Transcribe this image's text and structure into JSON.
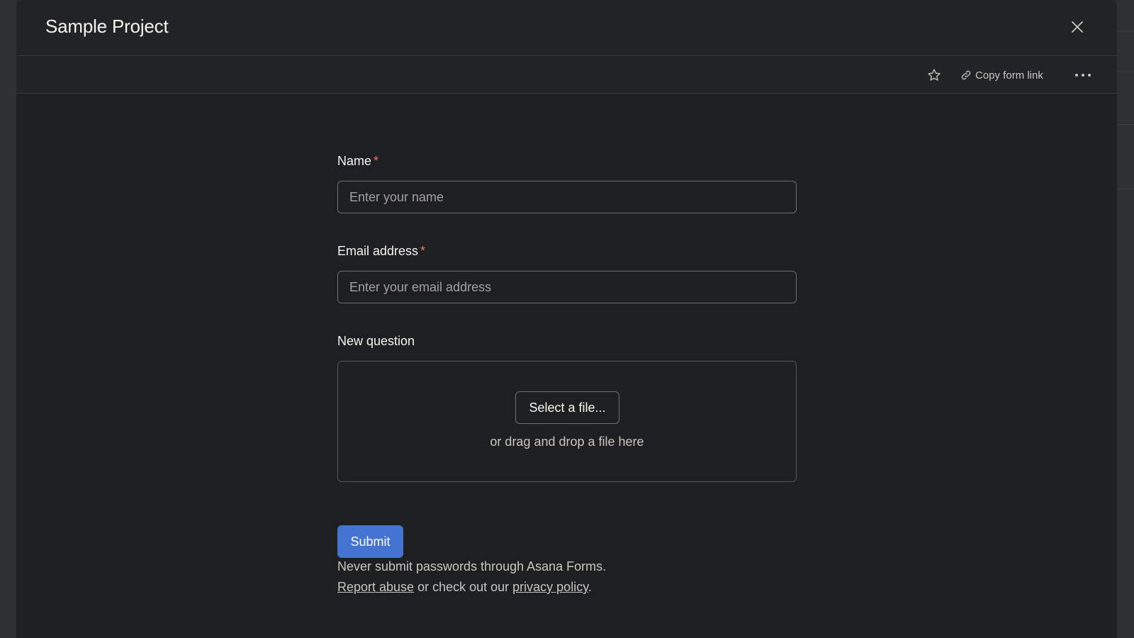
{
  "modal": {
    "title": "Sample Project"
  },
  "toolbar": {
    "copy_link_label": "Copy form link"
  },
  "form": {
    "fields": [
      {
        "label": "Name",
        "required_marker": "*",
        "placeholder": "Enter your name"
      },
      {
        "label": "Email address",
        "required_marker": "*",
        "placeholder": "Enter your email address"
      },
      {
        "label": "New question",
        "file_button_label": "Select a file...",
        "drop_hint": "or drag and drop a file here"
      }
    ],
    "submit_label": "Submit",
    "footer": {
      "warning": "Never submit passwords through Asana Forms.",
      "report_link": "Report abuse",
      "middle_text": " or check out our ",
      "privacy_link": "privacy policy",
      "end_text": "."
    }
  },
  "colors": {
    "accent": "#4573d2",
    "required": "#ef6e74",
    "background": "#1e1f21"
  },
  "icons": [
    "close-icon",
    "star-icon",
    "link-icon",
    "more-icon"
  ]
}
